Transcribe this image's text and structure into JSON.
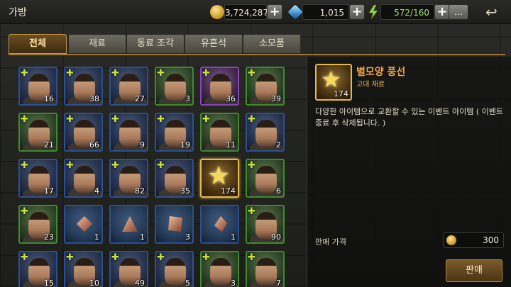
{
  "header": {
    "title": "가방"
  },
  "resources": {
    "gold": {
      "value": "3,724,287",
      "icon": "gold-coin-icon",
      "color": "#d9a520"
    },
    "gem": {
      "value": "1,015",
      "icon": "blue-gem-icon",
      "color": "#5ab4e8"
    },
    "stamina": {
      "value": "572/160",
      "icon": "lightning-icon",
      "color": "#8ed043",
      "value_color": "#a5e16b"
    }
  },
  "tabs": [
    "전체",
    "재료",
    "동료 조각",
    "유혼석",
    "소모품"
  ],
  "grid": {
    "rows": [
      [
        {
          "kind": "hero",
          "frame": "blue",
          "count": "16"
        },
        {
          "kind": "hero",
          "frame": "blue",
          "count": "38"
        },
        {
          "kind": "hero",
          "frame": "blue",
          "count": "27"
        },
        {
          "kind": "hero",
          "frame": "green",
          "count": "3"
        },
        {
          "kind": "hero",
          "frame": "purple",
          "count": "36"
        },
        {
          "kind": "hero",
          "frame": "green",
          "count": "39"
        }
      ],
      [
        {
          "kind": "hero",
          "frame": "green",
          "count": "21"
        },
        {
          "kind": "hero",
          "frame": "blue",
          "count": "66"
        },
        {
          "kind": "hero",
          "frame": "blue",
          "count": "9"
        },
        {
          "kind": "hero",
          "frame": "blue",
          "count": "19"
        },
        {
          "kind": "hero",
          "frame": "green",
          "count": "11"
        },
        {
          "kind": "hero",
          "frame": "blue",
          "count": "2"
        }
      ],
      [
        {
          "kind": "hero",
          "frame": "blue",
          "count": "17"
        },
        {
          "kind": "hero",
          "frame": "blue",
          "count": "4"
        },
        {
          "kind": "hero",
          "frame": "blue",
          "count": "82"
        },
        {
          "kind": "hero",
          "frame": "blue",
          "count": "35"
        },
        {
          "kind": "star",
          "frame": "gold",
          "count": "174"
        },
        {
          "kind": "hero",
          "frame": "green",
          "count": "6"
        }
      ],
      [
        {
          "kind": "hero",
          "frame": "green",
          "count": "23"
        },
        {
          "kind": "shard",
          "frame": "blue",
          "count": "1"
        },
        {
          "kind": "shard",
          "frame": "blue",
          "count": "1"
        },
        {
          "kind": "shard",
          "frame": "blue",
          "count": "3"
        },
        {
          "kind": "shard",
          "frame": "blue",
          "count": "1"
        },
        {
          "kind": "hero",
          "frame": "green",
          "count": "90"
        }
      ],
      [
        {
          "kind": "hero",
          "frame": "blue",
          "count": "15"
        },
        {
          "kind": "hero",
          "frame": "blue",
          "count": "10"
        },
        {
          "kind": "hero",
          "frame": "blue",
          "count": "49"
        },
        {
          "kind": "hero",
          "frame": "blue",
          "count": "5"
        },
        {
          "kind": "hero",
          "frame": "green",
          "count": "3"
        },
        {
          "kind": "hero",
          "frame": "green",
          "count": "7"
        }
      ]
    ]
  },
  "detail": {
    "name": "별모양 풍선",
    "grade": "고대 재료",
    "count": "174",
    "description": "다양한 아이템으로 교환할 수 있는 이벤트 아이템 ( 이벤트 종료 후 삭제됩니다. )",
    "price_label": "판매 가격",
    "price": "300",
    "sell_label": "판매"
  },
  "icons": {
    "plus": "+",
    "chat": "…",
    "back": "↩",
    "star": "★",
    "hero_mark": "✚"
  }
}
